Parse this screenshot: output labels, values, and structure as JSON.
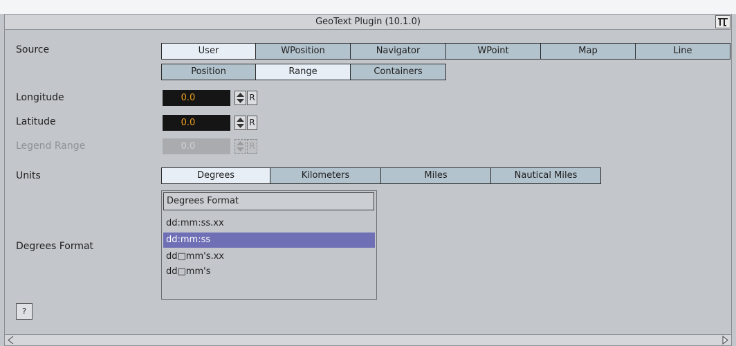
{
  "window": {
    "title": "GeoText Plugin (10.1.0)",
    "close_icon": "tool-icon"
  },
  "source": {
    "label": "Source",
    "row1": [
      {
        "label": "User",
        "active": true
      },
      {
        "label": "WPosition",
        "active": false
      },
      {
        "label": "Navigator",
        "active": false
      },
      {
        "label": "WPoint",
        "active": false
      },
      {
        "label": "Map",
        "active": false
      },
      {
        "label": "Line",
        "active": false
      }
    ],
    "row2": [
      {
        "label": "Position",
        "active": false
      },
      {
        "label": "Range",
        "active": true
      },
      {
        "label": "Containers",
        "active": false
      }
    ]
  },
  "longitude": {
    "label": "Longitude",
    "value": "0.0",
    "reset": "R"
  },
  "latitude": {
    "label": "Latitude",
    "value": "0.0",
    "reset": "R"
  },
  "legend_range": {
    "label": "Legend Range",
    "value": "0.0",
    "reset": "R",
    "disabled": true
  },
  "units": {
    "label": "Units",
    "options": [
      {
        "label": "Degrees",
        "active": true
      },
      {
        "label": "Kilometers",
        "active": false
      },
      {
        "label": "Miles",
        "active": false
      },
      {
        "label": "Nautical Miles",
        "active": false
      }
    ]
  },
  "degrees_format": {
    "label": "Degrees Format",
    "header": "Degrees Format",
    "items": [
      {
        "label": "dd:mm:ss.xx",
        "selected": false
      },
      {
        "label": "dd:mm:ss",
        "selected": true
      },
      {
        "label": "dd□mm's.xx",
        "selected": false
      },
      {
        "label": "dd□mm's",
        "selected": false
      }
    ]
  },
  "help": {
    "label": "?"
  },
  "colors": {
    "active_tab": "#e7eef6",
    "inactive_tab": "#b3c3cd",
    "selected_item": "#6f6fb6",
    "number_text": "#f0a020"
  }
}
